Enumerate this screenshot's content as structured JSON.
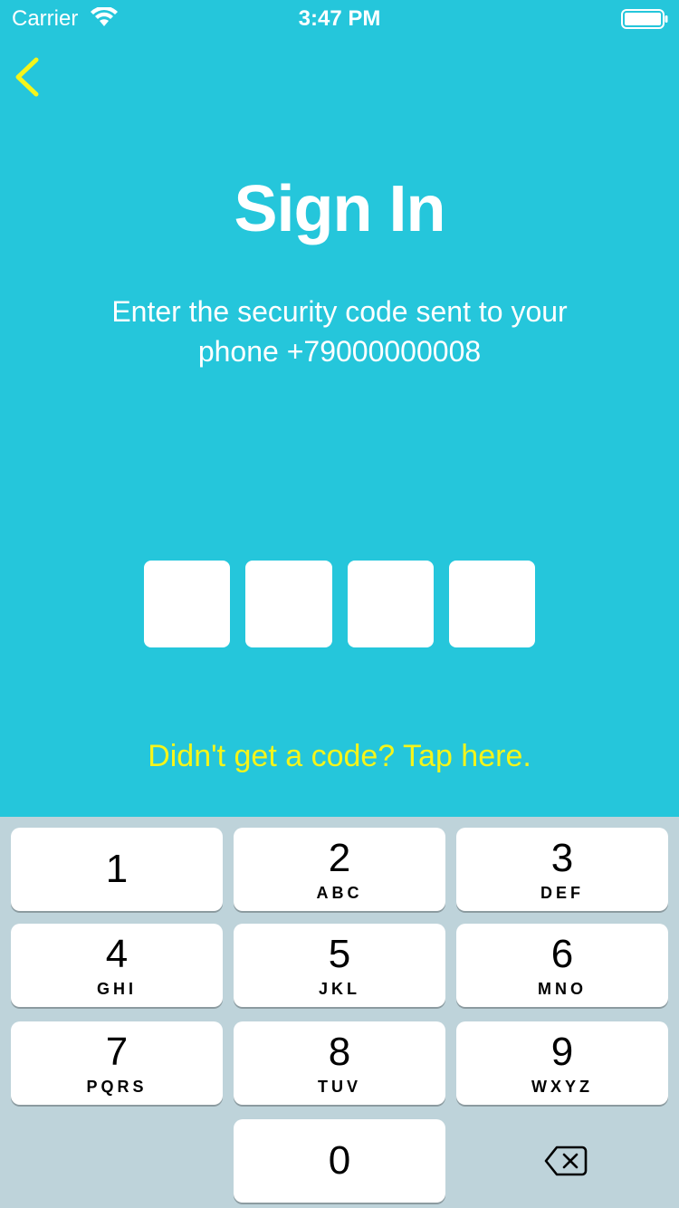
{
  "status_bar": {
    "carrier": "Carrier",
    "time": "3:47 PM"
  },
  "icons": {
    "back": "chevron-left-icon",
    "wifi": "wifi-icon",
    "battery": "battery-icon",
    "delete": "backspace-icon"
  },
  "colors": {
    "background": "#25c6db",
    "accent": "#f5f51a",
    "keypad_background": "#bed3da"
  },
  "screen": {
    "title": "Sign In",
    "subtitle_line1": "Enter the security code sent to your",
    "subtitle_line2": "phone +79000000008",
    "code_length": 4,
    "resend_link": "Didn't get a code? Tap here."
  },
  "keypad": {
    "keys": [
      {
        "digit": "1",
        "letters": ""
      },
      {
        "digit": "2",
        "letters": "ABC"
      },
      {
        "digit": "3",
        "letters": "DEF"
      },
      {
        "digit": "4",
        "letters": "GHI"
      },
      {
        "digit": "5",
        "letters": "JKL"
      },
      {
        "digit": "6",
        "letters": "MNO"
      },
      {
        "digit": "7",
        "letters": "PQRS"
      },
      {
        "digit": "8",
        "letters": "TUV"
      },
      {
        "digit": "9",
        "letters": "WXYZ"
      },
      {
        "digit": "0",
        "letters": ""
      }
    ]
  }
}
